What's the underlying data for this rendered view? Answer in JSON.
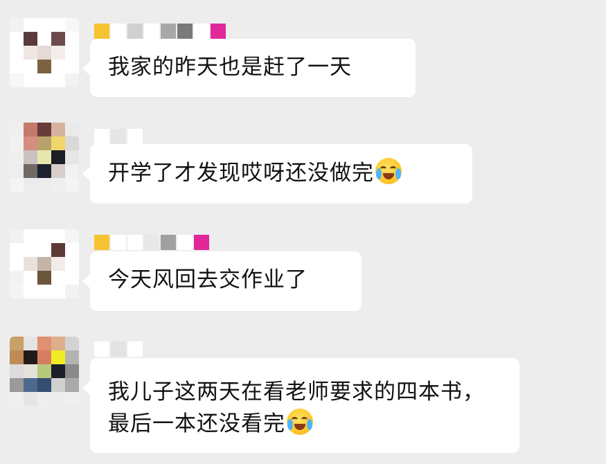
{
  "messages": [
    {
      "text": "我家的昨天也是赶了一天",
      "avatar_colors": [
        "#f2f2f2",
        "#ffffff",
        "#ffffff",
        "#ffffff",
        "#f7f7f7",
        "#ffffff",
        "#5a3b3b",
        "#ffffff",
        "#6e4b4b",
        "#ffffff",
        "#ffffff",
        "#f0e7e2",
        "#e6dad6",
        "#f3ecea",
        "#ffffff",
        "#ffffff",
        "#ffffff",
        "#7b6342",
        "#ffffff",
        "#ffffff",
        "#f7f7f7",
        "#ffffff",
        "#ffffff",
        "#ffffff",
        "#f2f2f2"
      ],
      "nickname_colors": [
        "#f5c330",
        "#ffffff",
        "#d0d0d0",
        "#ffffff",
        "#a8a8a8",
        "#7a7a7a",
        "#ffffff",
        "#e0289a"
      ],
      "has_emoji": false
    },
    {
      "text": "开学了才发现哎呀还没做完",
      "avatar_colors": [
        "#efefef",
        "#c47a6a",
        "#6b3b3a",
        "#d6b2a0",
        "#eaeaea",
        "#f1f1f1",
        "#d68c82",
        "#b7a36a",
        "#f0d56a",
        "#d9d9d9",
        "#efefef",
        "#c9c2c0",
        "#e7e7ad",
        "#1c1d26",
        "#e6e6e6",
        "#eeeeee",
        "#6f6a66",
        "#1b2330",
        "#d8cec9",
        "#f1f1f1",
        "#f4f4f4",
        "#ececec",
        "#ececec",
        "#efefef",
        "#f4f4f4"
      ],
      "nickname_colors": [
        "#ffffff",
        "#e6e6e6",
        "#ffffff",
        "#ededed"
      ],
      "has_emoji": true,
      "emoji_name": "laugh-cry-emoji"
    },
    {
      "text": "今天风回去交作业了",
      "avatar_colors": [
        "#f1f1f1",
        "#ffffff",
        "#ffffff",
        "#ffffff",
        "#f5f5f5",
        "#ffffff",
        "#ffffff",
        "#ffffff",
        "#5d3a36",
        "#ffffff",
        "#ffffff",
        "#e9e2dc",
        "#c4b4a8",
        "#f1ece8",
        "#ffffff",
        "#f2f2f2",
        "#ffffff",
        "#6b553b",
        "#ffffff",
        "#ffffff",
        "#f4f4f4",
        "#ffffff",
        "#ffffff",
        "#ffffff",
        "#f2f2f2"
      ],
      "nickname_colors": [
        "#f5c330",
        "#ffffff",
        "#ffffff",
        "#e8e8e8",
        "#a0a0a0",
        "#ffffff",
        "#e0289a"
      ],
      "has_emoji": false
    },
    {
      "text": "我儿子这两天在看老师要求的四本书，最后一本还没看完",
      "avatar_colors": [
        "#c9a06a",
        "#e4e4e4",
        "#e09070",
        "#ddaf8c",
        "#d3d3d3",
        "#bf8a58",
        "#201b18",
        "#d77c63",
        "#f2ec23",
        "#b3b3b3",
        "#dcdcdc",
        "#e4e2da",
        "#b7c97a",
        "#1c1f2b",
        "#8a8a8a",
        "#9a9a9a",
        "#4d6a8d",
        "#354d70",
        "#d0d0d0",
        "#a9a9a9",
        "#efefef",
        "#e6e6e6",
        "#eeeeee",
        "#ededed",
        "#f0f0f0"
      ],
      "nickname_colors": [
        "#ffffff",
        "#e3e3e3",
        "#ffffff"
      ],
      "has_emoji": true,
      "emoji_name": "laugh-cry-emoji"
    }
  ]
}
